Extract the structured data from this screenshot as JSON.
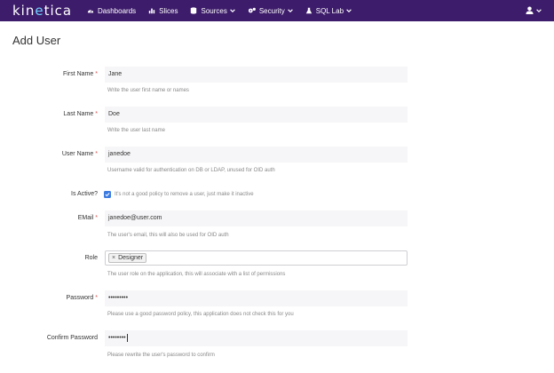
{
  "brand": {
    "logo_pre": "kin",
    "logo_hl": "e",
    "logo_post": "tica"
  },
  "nav": {
    "items": [
      {
        "label": "Dashboards",
        "icon": "dashboard-icon",
        "dropdown": false
      },
      {
        "label": "Slices",
        "icon": "bar-chart-icon",
        "dropdown": false
      },
      {
        "label": "Sources",
        "icon": "database-icon",
        "dropdown": true
      },
      {
        "label": "Security",
        "icon": "gears-icon",
        "dropdown": true
      },
      {
        "label": "SQL Lab",
        "icon": "flask-icon",
        "dropdown": true
      }
    ],
    "user_icon": "user-icon"
  },
  "page": {
    "title": "Add User"
  },
  "form": {
    "first_name": {
      "label": "First Name",
      "value": "Jane",
      "help": "Write the user first name or names"
    },
    "last_name": {
      "label": "Last Name",
      "value": "Doe",
      "help": "Write the user last name"
    },
    "user_name": {
      "label": "User Name",
      "value": "janedoe",
      "help": "Username valid for authentication on DB or LDAP, unused for OID auth"
    },
    "is_active": {
      "label": "Is Active?",
      "checked": true,
      "help": "It's not a good policy to remove a user, just make it inactive"
    },
    "email": {
      "label": "EMail",
      "value": "janedoe@user.com",
      "help": "The user's email, this will also be used for OID auth"
    },
    "role": {
      "label": "Role",
      "tags": [
        "Designer"
      ],
      "help": "The user role on the application, this will associate with a list of permissions"
    },
    "password": {
      "label": "Password",
      "value": "•••••••••",
      "help": "Please use a good password policy, this application does not check this for you"
    },
    "confirm_password": {
      "label": "Confirm Password",
      "value": "••••••••",
      "help": "Please rewrite the user's password to confirm"
    }
  },
  "colors": {
    "navbar": "#3d1c6b",
    "accent": "#6fd3ff",
    "required": "#d9534f",
    "checkbox": "#3d7be0"
  }
}
